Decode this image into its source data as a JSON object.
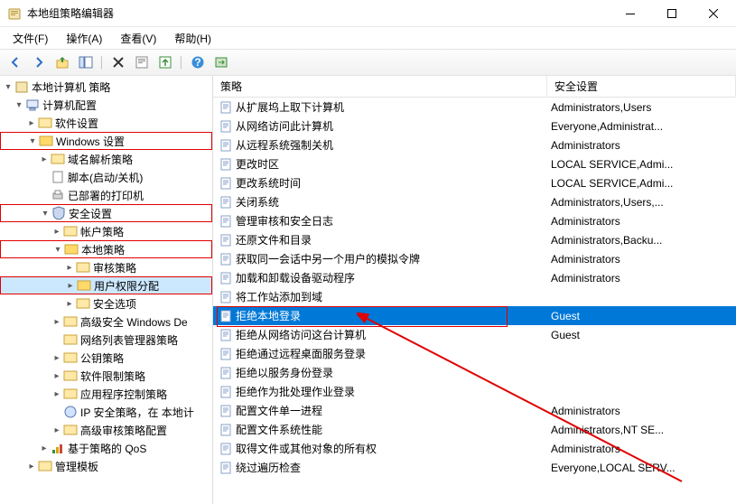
{
  "window": {
    "title": "本地组策略编辑器"
  },
  "menu": {
    "file": "文件(F)",
    "action": "操作(A)",
    "view": "查看(V)",
    "help": "帮助(H)"
  },
  "tree": {
    "root": "本地计算机 策略",
    "computer_config": "计算机配置",
    "software": "软件设置",
    "windows_settings": "Windows 设置",
    "dns": "域名解析策略",
    "scripts": "脚本(启动/关机)",
    "printers": "已部署的打印机",
    "security": "安全设置",
    "account_policy": "帐户策略",
    "local_policy": "本地策略",
    "audit": "审核策略",
    "user_rights": "用户权限分配",
    "security_options": "安全选项",
    "advanced_fw": "高级安全 Windows De",
    "netlist": "网络列表管理器策略",
    "pubkey": "公钥策略",
    "swrestrict": "软件限制策略",
    "appctrl": "应用程序控制策略",
    "ipsec": "IP 安全策略，在 本地计",
    "advaudit": "高级审核策略配置",
    "qos": "基于策略的 QoS",
    "admin_templates": "管理模板"
  },
  "columns": {
    "policy": "策略",
    "setting": "安全设置"
  },
  "policies": [
    {
      "name": "从扩展坞上取下计算机",
      "setting": "Administrators,Users"
    },
    {
      "name": "从网络访问此计算机",
      "setting": "Everyone,Administrat..."
    },
    {
      "name": "从远程系统强制关机",
      "setting": "Administrators"
    },
    {
      "name": "更改时区",
      "setting": "LOCAL SERVICE,Admi..."
    },
    {
      "name": "更改系统时间",
      "setting": "LOCAL SERVICE,Admi..."
    },
    {
      "name": "关闭系统",
      "setting": "Administrators,Users,..."
    },
    {
      "name": "管理审核和安全日志",
      "setting": "Administrators"
    },
    {
      "name": "还原文件和目录",
      "setting": "Administrators,Backu..."
    },
    {
      "name": "获取同一会话中另一个用户的模拟令牌",
      "setting": "Administrators"
    },
    {
      "name": "加载和卸载设备驱动程序",
      "setting": "Administrators"
    },
    {
      "name": "将工作站添加到域",
      "setting": ""
    },
    {
      "name": "拒绝本地登录",
      "setting": "Guest",
      "selected": true,
      "red": true
    },
    {
      "name": "拒绝从网络访问这台计算机",
      "setting": "Guest"
    },
    {
      "name": "拒绝通过远程桌面服务登录",
      "setting": ""
    },
    {
      "name": "拒绝以服务身份登录",
      "setting": ""
    },
    {
      "name": "拒绝作为批处理作业登录",
      "setting": ""
    },
    {
      "name": "配置文件单一进程",
      "setting": "Administrators"
    },
    {
      "name": "配置文件系统性能",
      "setting": "Administrators,NT SE..."
    },
    {
      "name": "取得文件或其他对象的所有权",
      "setting": "Administrators"
    },
    {
      "name": "绕过遍历检查",
      "setting": "Everyone,LOCAL SERV..."
    }
  ]
}
